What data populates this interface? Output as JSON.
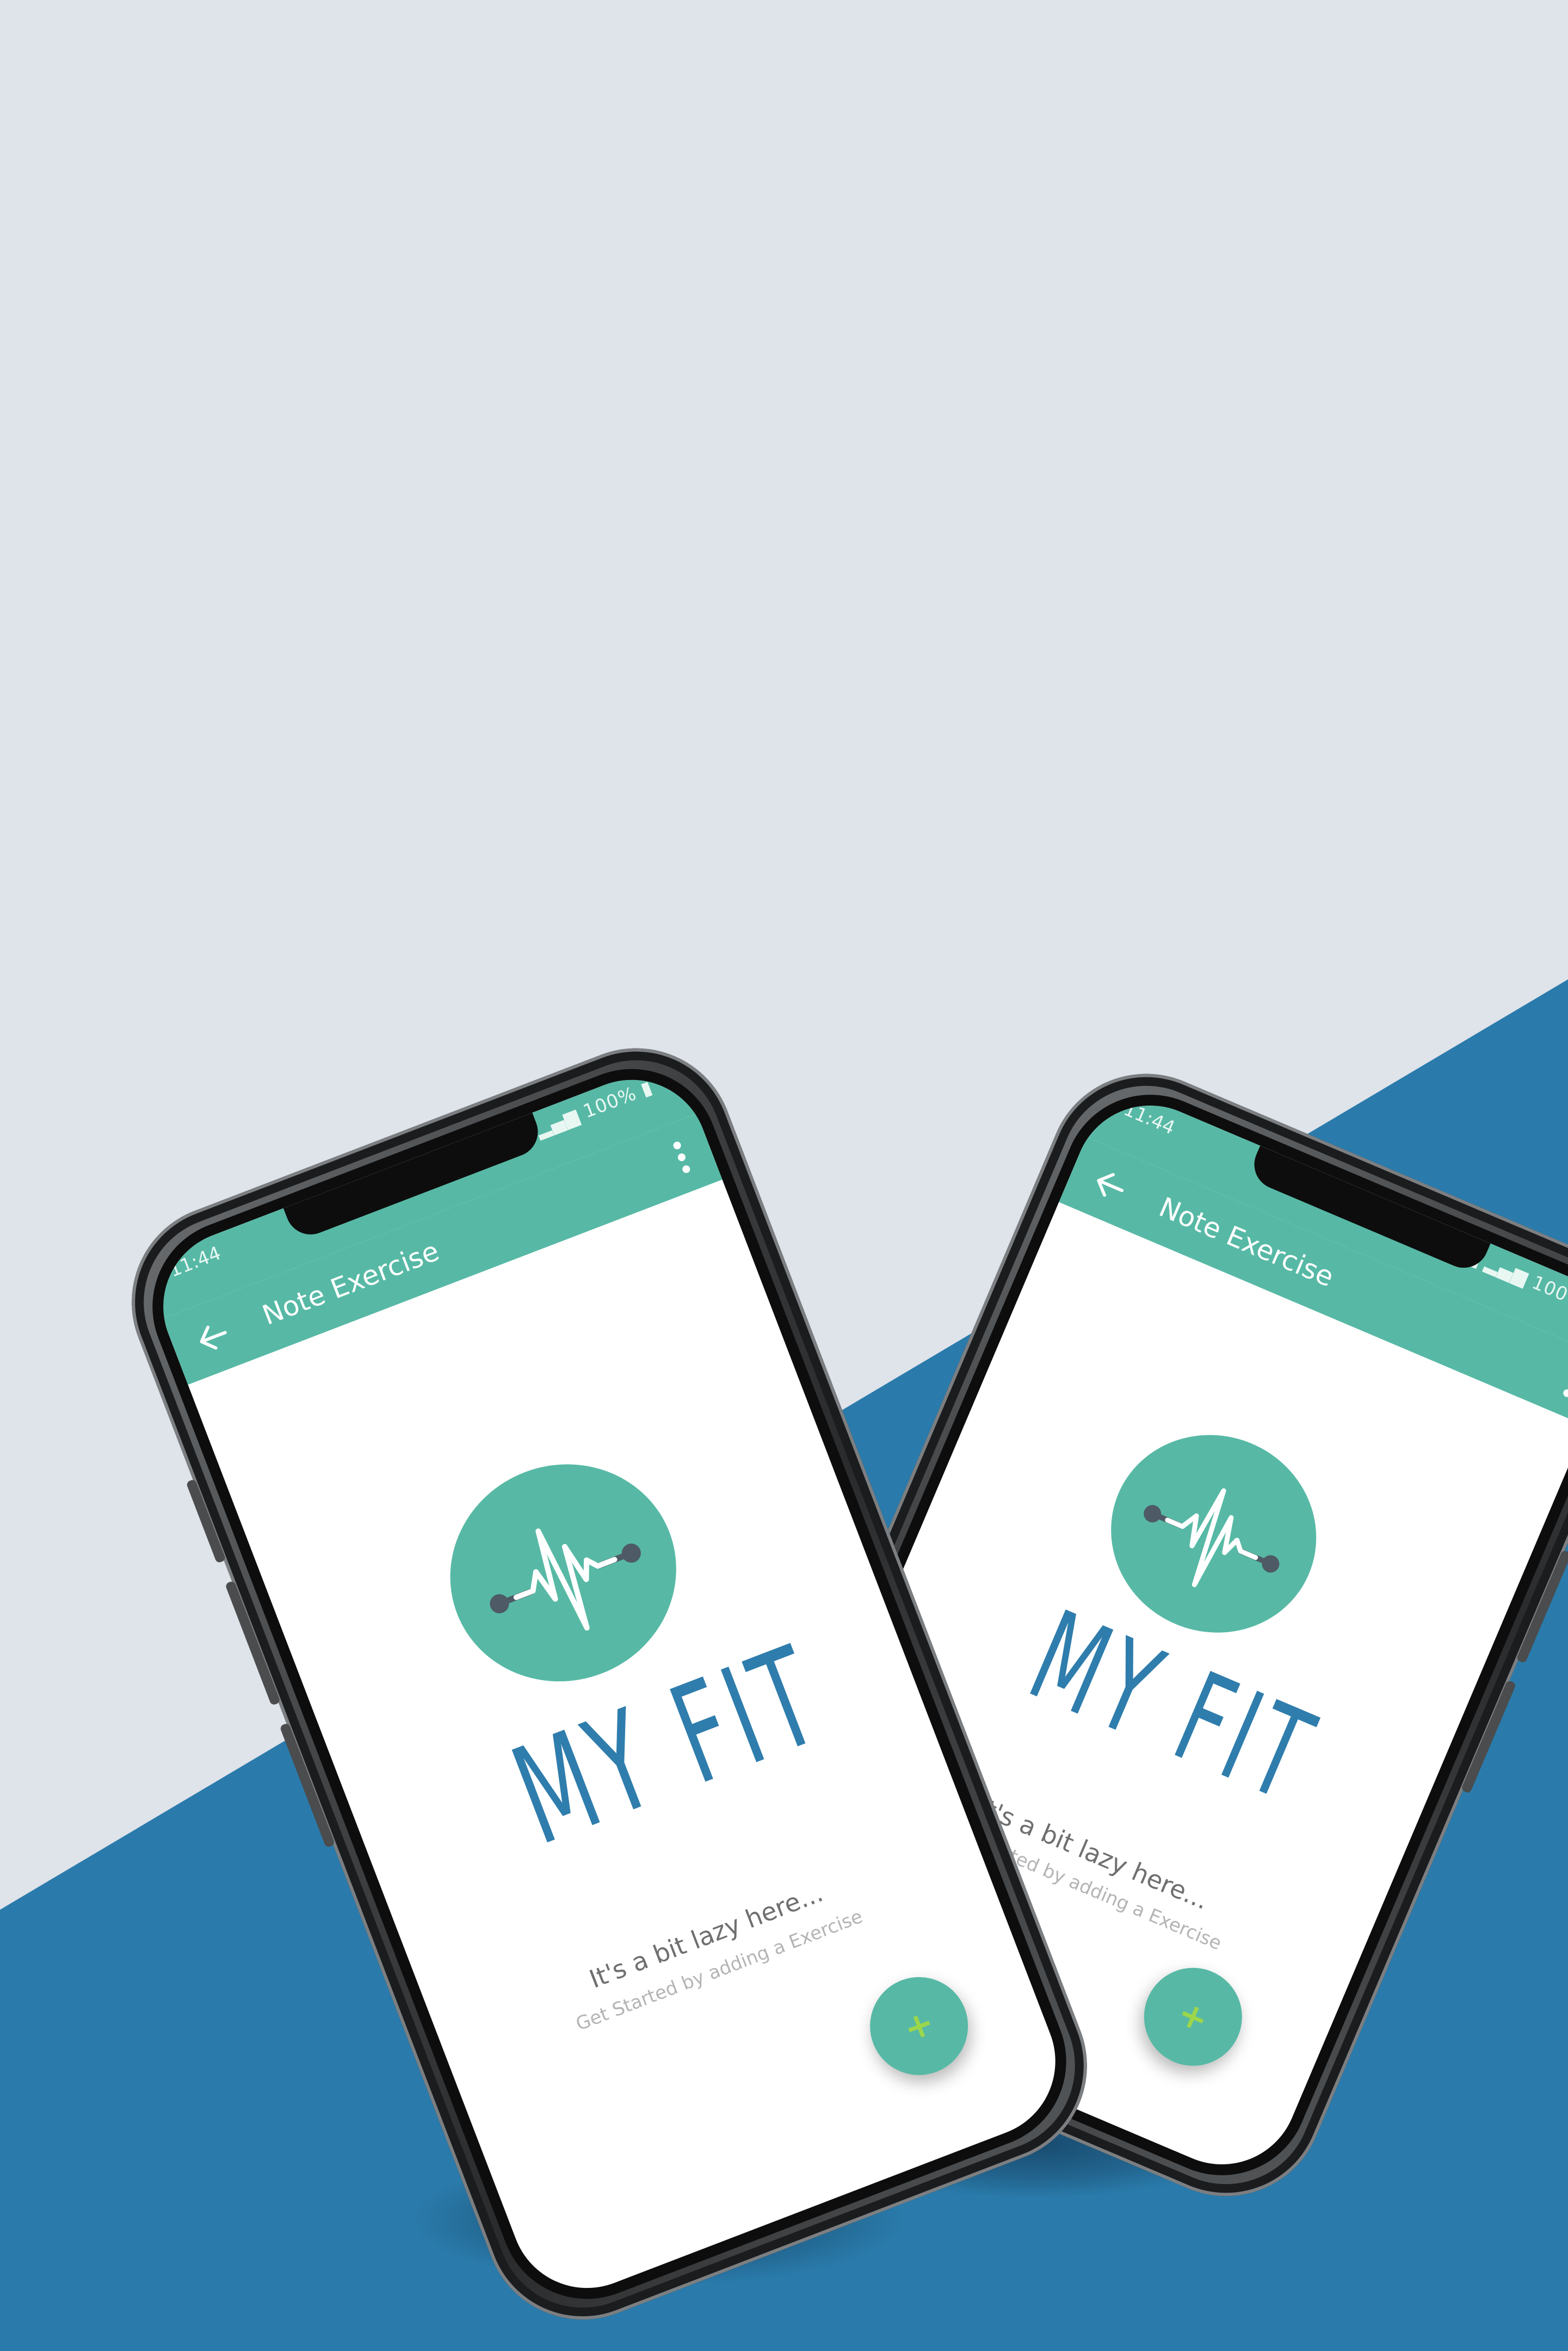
{
  "colors": {
    "background_top": "#dfe3ea",
    "background_bottom": "#2a7bab",
    "primary": "#57b9a5",
    "logo_text": "#2f7dac",
    "fab_icon": "#9cd64a"
  },
  "status_bar": {
    "time": "11:44",
    "battery": "100%",
    "signal_icon": "signal-icon",
    "battery_icon": "battery-icon"
  },
  "app_bar": {
    "title": "Note Exercise",
    "back_icon": "arrow-left-icon",
    "menu_icon": "more-vert-icon"
  },
  "logo": {
    "text": "MY FIT",
    "icon": "heartbeat-dumbbell-icon"
  },
  "empty_state": {
    "title": "It's a bit lazy here...",
    "subtitle": "Get Started by adding a Exercise"
  },
  "fab": {
    "label": "+",
    "icon": "plus-icon"
  }
}
